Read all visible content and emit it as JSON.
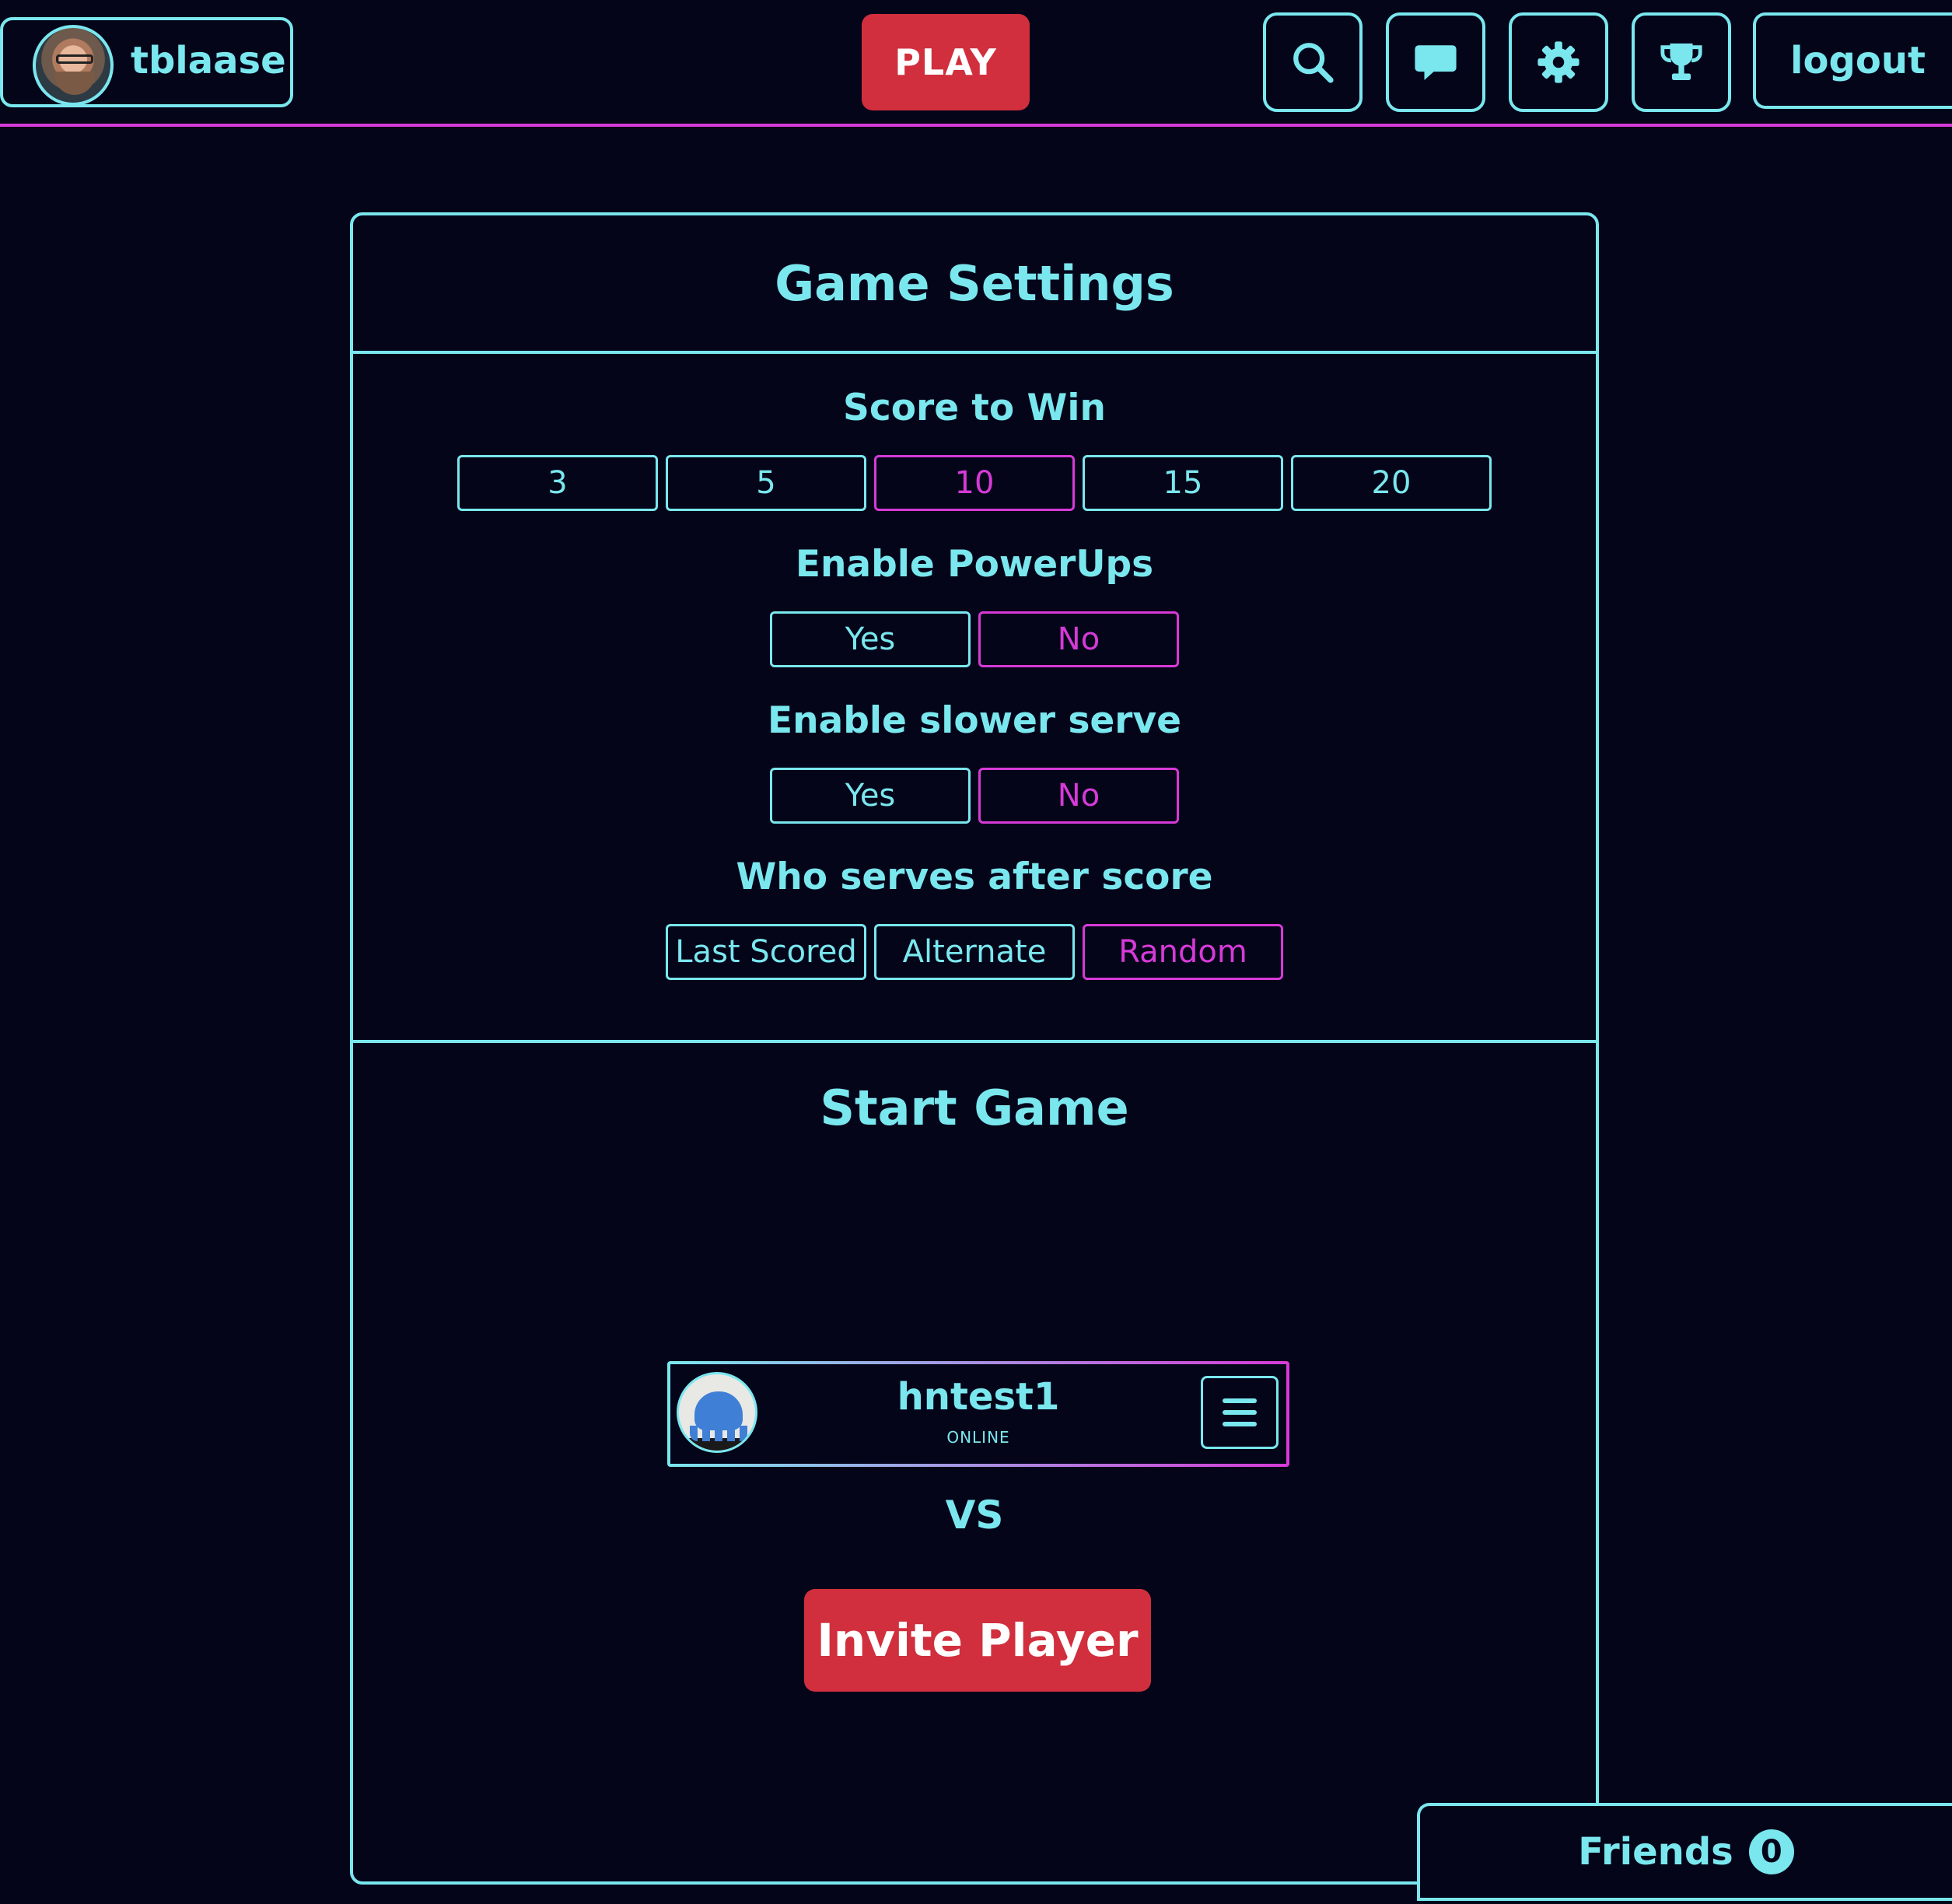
{
  "topbar": {
    "username": "tblaase",
    "play_label": "PLAY",
    "logout_label": "logout",
    "icons": [
      "search-icon",
      "chat-icon",
      "gear-icon",
      "trophy-icon"
    ]
  },
  "settings": {
    "title": "Game Settings",
    "score_to_win": {
      "label": "Score to Win",
      "options": [
        "3",
        "5",
        "10",
        "15",
        "20"
      ],
      "selected": "10"
    },
    "powerups": {
      "label": "Enable PowerUps",
      "options": [
        "Yes",
        "No"
      ],
      "selected": "No"
    },
    "slower_serve": {
      "label": "Enable slower serve",
      "options": [
        "Yes",
        "No"
      ],
      "selected": "No"
    },
    "who_serves": {
      "label": "Who serves after score",
      "options": [
        "Last Scored",
        "Alternate",
        "Random"
      ],
      "selected": "Random"
    }
  },
  "start_game": {
    "title": "Start Game",
    "vs_label": "VS",
    "opponent": {
      "name": "hntest1",
      "status": "ONLINE"
    },
    "invite_label": "Invite Player"
  },
  "friends": {
    "label": "Friends",
    "count": "0"
  },
  "colors": {
    "background": "#05051a",
    "accent": "#7ae7ee",
    "selected": "#d63ad7",
    "primary_button": "#d12f3d"
  }
}
